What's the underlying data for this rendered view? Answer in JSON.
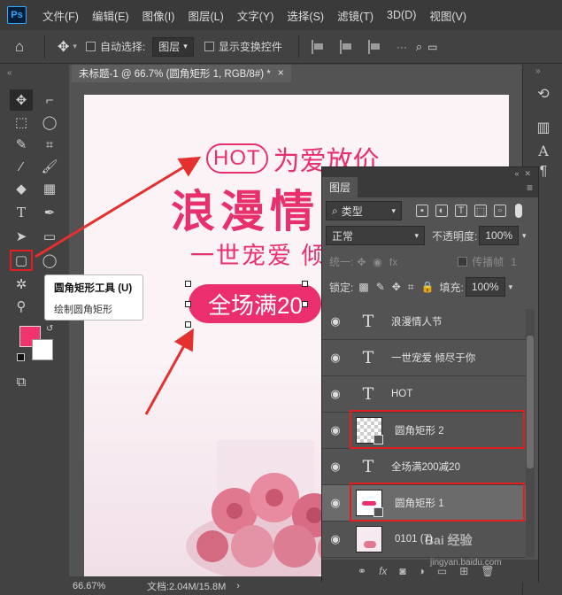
{
  "app": {
    "logo": "Ps"
  },
  "menu": [
    "文件(F)",
    "编辑(E)",
    "图像(I)",
    "图层(L)",
    "文字(Y)",
    "选择(S)",
    "滤镜(T)",
    "3D(D)",
    "视图(V)"
  ],
  "options": {
    "auto_select_label": "自动选择:",
    "auto_select_value": "图层",
    "show_transform_label": "显示变换控件"
  },
  "document_tab": {
    "title": "未标题-1 @ 66.7% (圆角矩形 1, RGB/8#) *",
    "close": "×"
  },
  "tooltip": {
    "title": "圆角矩形工具 (U)",
    "description": "绘制圆角矩形"
  },
  "canvas_text": {
    "hot": "HOT",
    "hot_tail": "为爱放价",
    "title": "浪漫情",
    "subtitle": "一世宠爱  倾",
    "promo": "全场满20"
  },
  "status": {
    "zoom": "66.67%",
    "doc_label": "文档:2.04M/15.8M",
    "arrow": "›"
  },
  "layers_panel": {
    "tab": "图层",
    "filter_type": "类型",
    "blend_mode": "正常",
    "opacity_label": "不透明度:",
    "opacity_value": "100%",
    "unify_label": "统一:",
    "propagate_label": "传播帧",
    "propagate_value": "1",
    "lock_label": "锁定:",
    "fill_label": "填充:",
    "fill_value": "100%",
    "layers": [
      {
        "name": "浪漫情人节",
        "kind": "text"
      },
      {
        "name": "一世宠爱  倾尽于你",
        "kind": "text"
      },
      {
        "name": "HOT",
        "kind": "text"
      },
      {
        "name": "圆角矩形 2",
        "kind": "shape"
      },
      {
        "name": "全场满200减20",
        "kind": "text"
      },
      {
        "name": "圆角矩形 1",
        "kind": "shape",
        "selected": true
      },
      {
        "name": "0101 (7)",
        "kind": "image"
      }
    ]
  },
  "watermark": {
    "main": "Bai 经验",
    "sub": "jingyan.baidu.com"
  },
  "colors": {
    "accent_pink": "#e8306c",
    "foreground_color": "#f2336c",
    "background_color": "#ffffff",
    "highlight_red": "#e02020"
  }
}
